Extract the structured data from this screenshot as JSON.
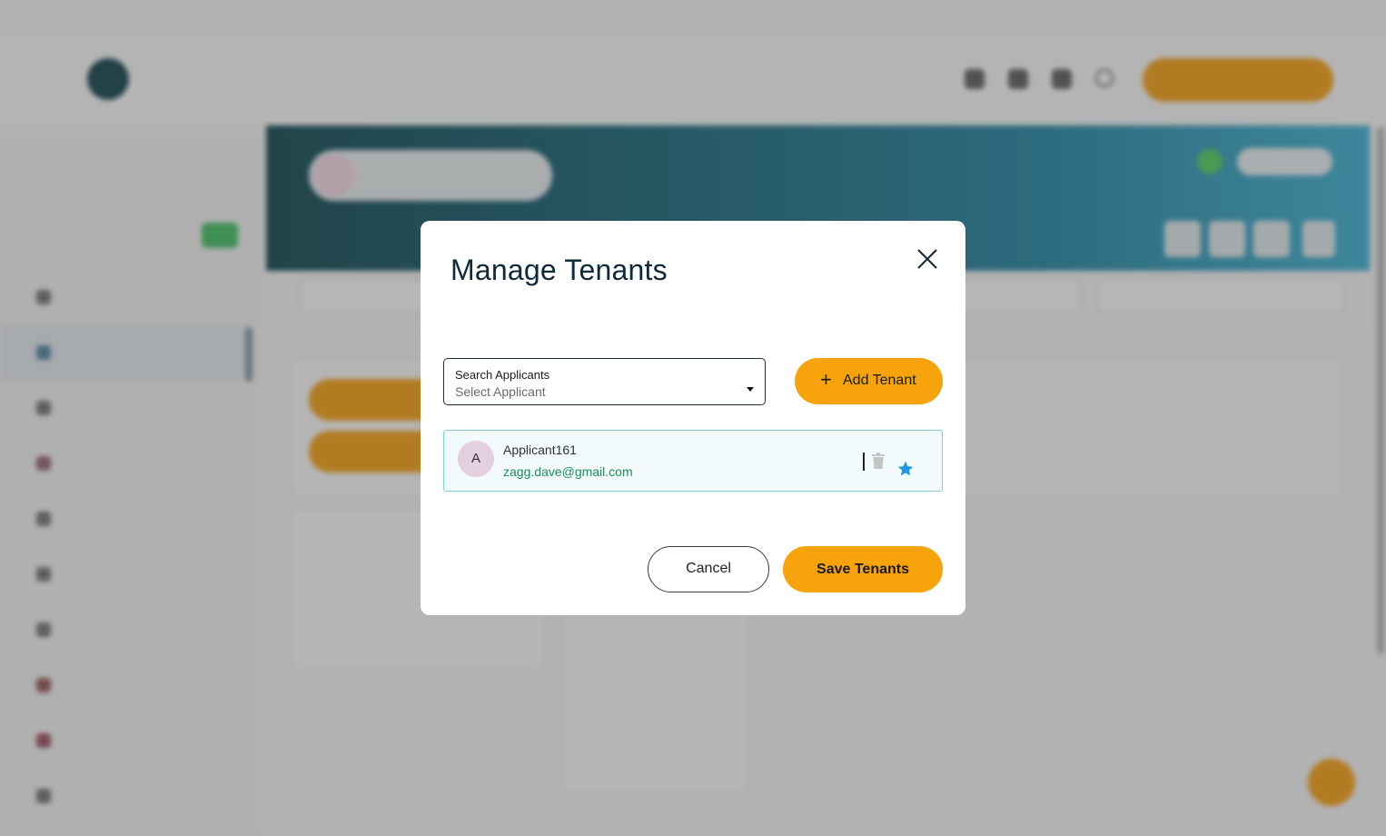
{
  "background": {
    "top_links": [
      "",
      "",
      "",
      ""
    ],
    "sidebar": {
      "stats": [
        {
          "label": "",
          "value": ""
        },
        {
          "label": "",
          "value": ""
        },
        {
          "label": "",
          "value": ""
        }
      ],
      "items": [
        {
          "icon": "details-icon"
        },
        {
          "icon": "tenants-icon"
        },
        {
          "icon": "checklist-icon"
        },
        {
          "icon": "renewals-checklist-icon"
        },
        {
          "icon": "compliance-icon"
        },
        {
          "icon": "rent-insurance-icon"
        },
        {
          "icon": "information-icon"
        },
        {
          "icon": "documents-icon"
        },
        {
          "icon": "journal-icon"
        },
        {
          "icon": "e-sign-icon"
        }
      ]
    },
    "colors": {
      "accent": "#f7a30c",
      "hero_dark": "#1d525a",
      "hero_light": "#49b4d2"
    }
  },
  "modal": {
    "title": "Manage Tenants",
    "subtitle": "",
    "close_icon": "close-icon",
    "search": {
      "label": "Search Applicants",
      "placeholder": "Select Applicant"
    },
    "add_button": {
      "icon": "+",
      "label": "Add Tenant"
    },
    "tenant": {
      "initial": "A",
      "name": "Applicant161",
      "email": "zagg.dave@gmail.com",
      "lead_icon": "star-icon",
      "delete_icon": "trash-icon"
    },
    "cancel_label": "Cancel",
    "save_label": "Save Tenants"
  }
}
